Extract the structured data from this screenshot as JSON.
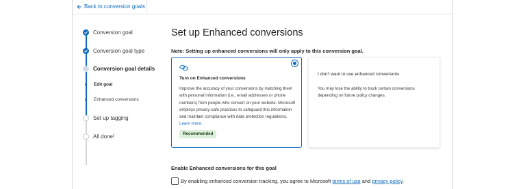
{
  "topbar": {
    "back_label": "Back to conversion goals",
    "back_icon": "arrow-left-icon"
  },
  "stepper": {
    "steps": [
      {
        "label": "Conversion goal",
        "state": "done"
      },
      {
        "label": "Conversion goal type",
        "state": "done"
      },
      {
        "label": "Conversion goal details",
        "state": "current"
      },
      {
        "label": "Edit goal",
        "state": "sub"
      },
      {
        "label": "Enhanced conversions",
        "state": "sub-current"
      },
      {
        "label": "Set up tagging",
        "state": "future"
      },
      {
        "label": "All done!",
        "state": "future"
      }
    ]
  },
  "main": {
    "title": "Set up Enhanced conversions",
    "note": "Note: Setting up enhanced conversions will only apply to this conversion goal.",
    "option_on": {
      "title": "Turn on Enhanced conversions",
      "body": "Improve the accuracy of your conversions by matching them with personal information (i.e., email addresses or phone numbers) from people who convert on your website. Microsoft employs privacy-safe practices to safeguard this information and maintain compliance with data protection regulations.",
      "learn_more": "Learn more.",
      "badge": "Recommended",
      "icon": "link-icon",
      "selected": true
    },
    "option_off": {
      "title": "I don't want to use enhanced conversions",
      "body": "You may lose the ability to track certain conversions depending on future policy changes.",
      "selected": false
    },
    "enable_label": "Enable Enhanced conversions for this goal",
    "consent": {
      "prefix": "By enabling enhanced conversion tracking, you agree to Microsoft",
      "terms_link": "terms of use",
      "conjunction": "and",
      "privacy_link": "privacy policy",
      "suffix": ".",
      "checked": false
    }
  },
  "colors": {
    "accent": "#0f6cbd",
    "badge_bg": "#dcf0dc",
    "current_dot": "#d3dde8"
  }
}
